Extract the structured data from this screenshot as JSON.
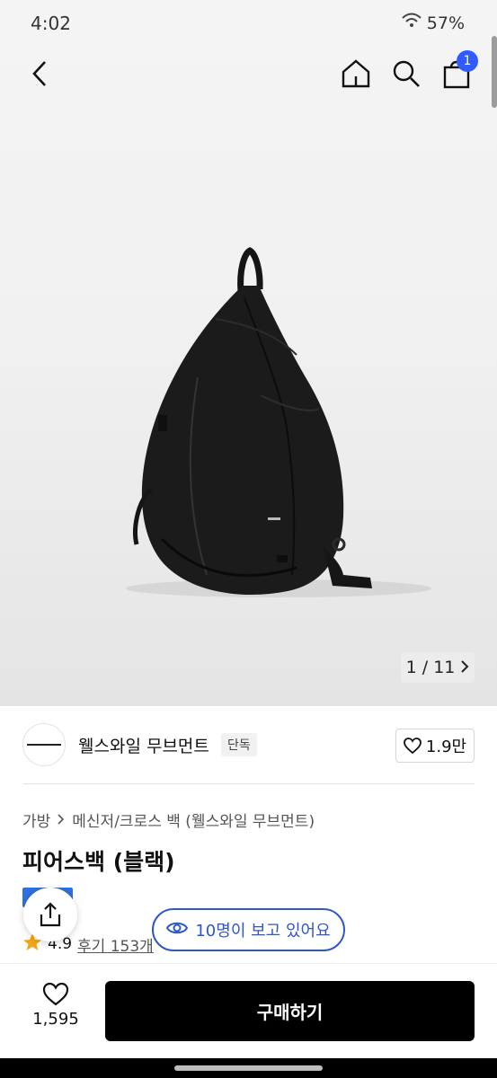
{
  "status_bar": {
    "time": "4:02",
    "battery": "57%"
  },
  "header": {
    "cart_count": "1"
  },
  "gallery": {
    "counter": "1 / 11"
  },
  "brand": {
    "name": "웰스와일 무브먼트",
    "tag": "단독",
    "likes": "1.9만"
  },
  "breadcrumb": {
    "category": "가방",
    "subcategory": "메신저/크로스 백 (웰스와일 무브먼트)"
  },
  "product": {
    "title": "피어스백 (블랙)",
    "rating": "4.9",
    "reviews": "후기 153개"
  },
  "viewers": {
    "text": "10명이 보고 있어요"
  },
  "bottom": {
    "wish_count": "1,595",
    "buy_label": "구매하기"
  },
  "colors": {
    "accent": "#2f5bff",
    "viewers": "#2f57c9",
    "star": "#f2a516"
  }
}
